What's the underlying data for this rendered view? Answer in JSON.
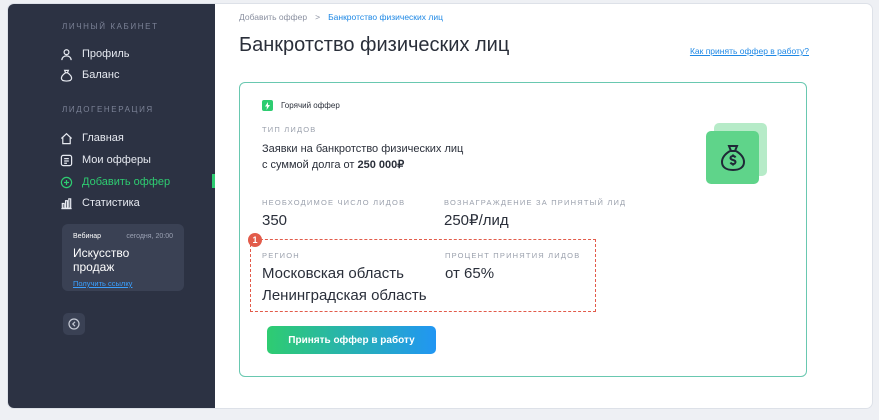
{
  "sidebar": {
    "section_account": "ЛИЧНЫЙ КАБИНЕТ",
    "profile": "Профиль",
    "balance": "Баланс",
    "section_leads": "ЛИДОГЕНЕРАЦИЯ",
    "home": "Главная",
    "my_offers": "Мои офферы",
    "add_offer": "Добавить оффер",
    "stats": "Статистика",
    "webinar": {
      "tag": "Вебинар",
      "time": "сегодня, 20:00",
      "title": "Искусство продаж",
      "link": "Получить ссылку"
    }
  },
  "breadcrumb": {
    "parent": "Добавить оффер",
    "separator": ">",
    "current": "Банкротство физических лиц"
  },
  "page": {
    "title": "Банкротство физических лиц",
    "help_link": "Как принять оффер в работу?"
  },
  "offer": {
    "hot_label": "Горячий оффер",
    "lead_type_label": "ТИП ЛИДОВ",
    "lead_type_line1": "Заявки на банкротство физических лиц",
    "lead_type_line2_prefix": "с суммой долга от ",
    "lead_type_amount": "250 000₽",
    "leads_needed_label": "НЕОБХОДИМОЕ ЧИСЛО ЛИДОВ",
    "leads_needed_value": "350",
    "reward_label": "ВОЗНАГРАЖДЕНИЕ ЗА ПРИНЯТЫЙ ЛИД",
    "reward_value": "250₽/лид",
    "region_label": "РЕГИОН",
    "region_1": "Московская область",
    "region_2": "Ленинградская область",
    "accept_rate_label": "ПРОЦЕНТ ПРИНЯТИЯ ЛИДОВ",
    "accept_rate_value": "от 65%",
    "annotation_number": "1",
    "cta_label": "Принять оффер в работу"
  },
  "colors": {
    "sidebar_bg": "#2c3243",
    "accent_green": "#2ecc71",
    "link_blue": "#1e88e5",
    "card_border": "#69c8b0",
    "annotation_red": "#e25b4a"
  }
}
